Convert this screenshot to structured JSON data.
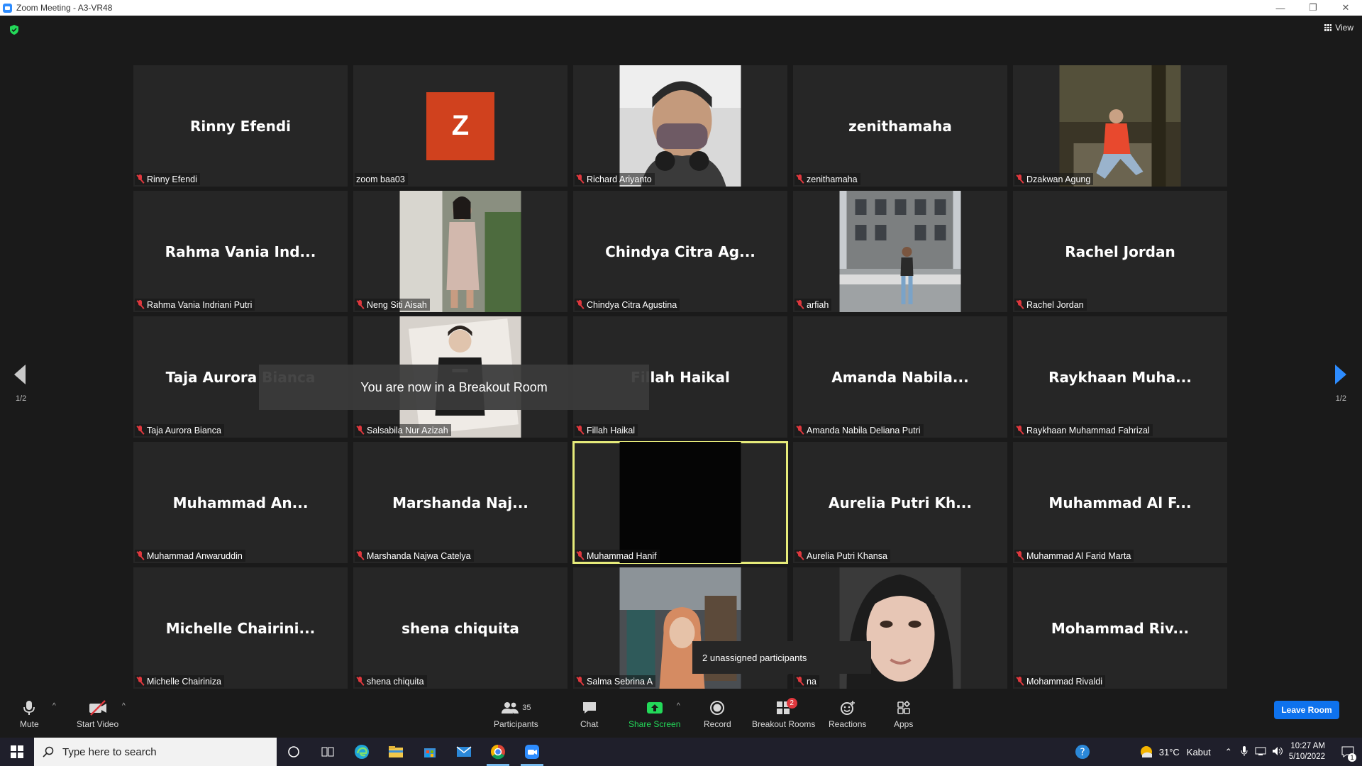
{
  "window": {
    "title": "Zoom Meeting - A3-VR48",
    "minimize": "—",
    "restore": "❐",
    "close": "✕"
  },
  "view_button": "View",
  "pagination": {
    "indicator": "1/2"
  },
  "toast": "You are now in a Breakout Room",
  "tooltip": "2 unassigned participants",
  "tiles": [
    {
      "display": "Rinny Efendi",
      "label": "Rinny Efendi",
      "muted": true
    },
    {
      "display": "Z",
      "label": "zoom baa03",
      "muted": false
    },
    {
      "display": "",
      "label": "Richard Ariyanto",
      "muted": true
    },
    {
      "display": "zenithamaha",
      "label": "zenithamaha",
      "muted": true
    },
    {
      "display": "",
      "label": "Dzakwan Agung",
      "muted": true
    },
    {
      "display": "Rahma Vania Ind...",
      "label": "Rahma Vania Indriani Putri",
      "muted": true
    },
    {
      "display": "",
      "label": "Neng Siti Aisah",
      "muted": true
    },
    {
      "display": "Chindya Citra Ag...",
      "label": "Chindya Citra Agustina",
      "muted": true
    },
    {
      "display": "",
      "label": "arfiah",
      "muted": true
    },
    {
      "display": "Rachel Jordan",
      "label": "Rachel Jordan",
      "muted": true
    },
    {
      "display": "Taja Aurora Bianca",
      "label": "Taja Aurora Bianca",
      "muted": true
    },
    {
      "display": "",
      "label": "Salsabila Nur Azizah",
      "muted": true
    },
    {
      "display": "Fillah Haikal",
      "label": "Fillah Haikal",
      "muted": true
    },
    {
      "display": "Amanda Nabila...",
      "label": "Amanda Nabila Deliana Putri",
      "muted": true
    },
    {
      "display": "Raykhaan Muha...",
      "label": "Raykhaan Muhammad Fahrizal",
      "muted": true
    },
    {
      "display": "Muhammad An...",
      "label": "Muhammad Anwaruddin",
      "muted": true
    },
    {
      "display": "Marshanda Naj...",
      "label": "Marshanda Najwa Catelya",
      "muted": true
    },
    {
      "display": "",
      "label": "Muhammad Hanif",
      "muted": true
    },
    {
      "display": "Aurelia Putri Kh...",
      "label": "Aurelia Putri Khansa",
      "muted": true
    },
    {
      "display": "Muhammad Al F...",
      "label": "Muhammad Al Farid Marta",
      "muted": true
    },
    {
      "display": "Michelle Chairini...",
      "label": "Michelle Chairiniza",
      "muted": true
    },
    {
      "display": "shena chiquita",
      "label": "shena chiquita",
      "muted": true
    },
    {
      "display": "",
      "label": "Salma Sebrina A",
      "muted": true
    },
    {
      "display": "",
      "label": "na",
      "muted": true
    },
    {
      "display": "Mohammad Riv...",
      "label": "Mohammad Rivaldi",
      "muted": true
    }
  ],
  "toolbar": {
    "mute": "Mute",
    "start_video": "Start Video",
    "participants": "Participants",
    "participants_count": "35",
    "chat": "Chat",
    "share_screen": "Share Screen",
    "record": "Record",
    "breakout_rooms": "Breakout Rooms",
    "breakout_badge": "2",
    "reactions": "Reactions",
    "apps": "Apps",
    "leave_room": "Leave Room"
  },
  "taskbar": {
    "search_placeholder": "Type here to search",
    "weather_temp": "31°C",
    "weather_text": "Kabut",
    "time": "10:27 AM",
    "date": "5/10/2022",
    "notification_count": "1"
  },
  "colors": {
    "zoom_blue": "#2d8cff",
    "leave_blue": "#0e72ed",
    "mute_red": "#e0383e",
    "active_speaker": "#e6eb7a",
    "share_green": "#23d959",
    "avatar_orange": "#d0411e"
  }
}
